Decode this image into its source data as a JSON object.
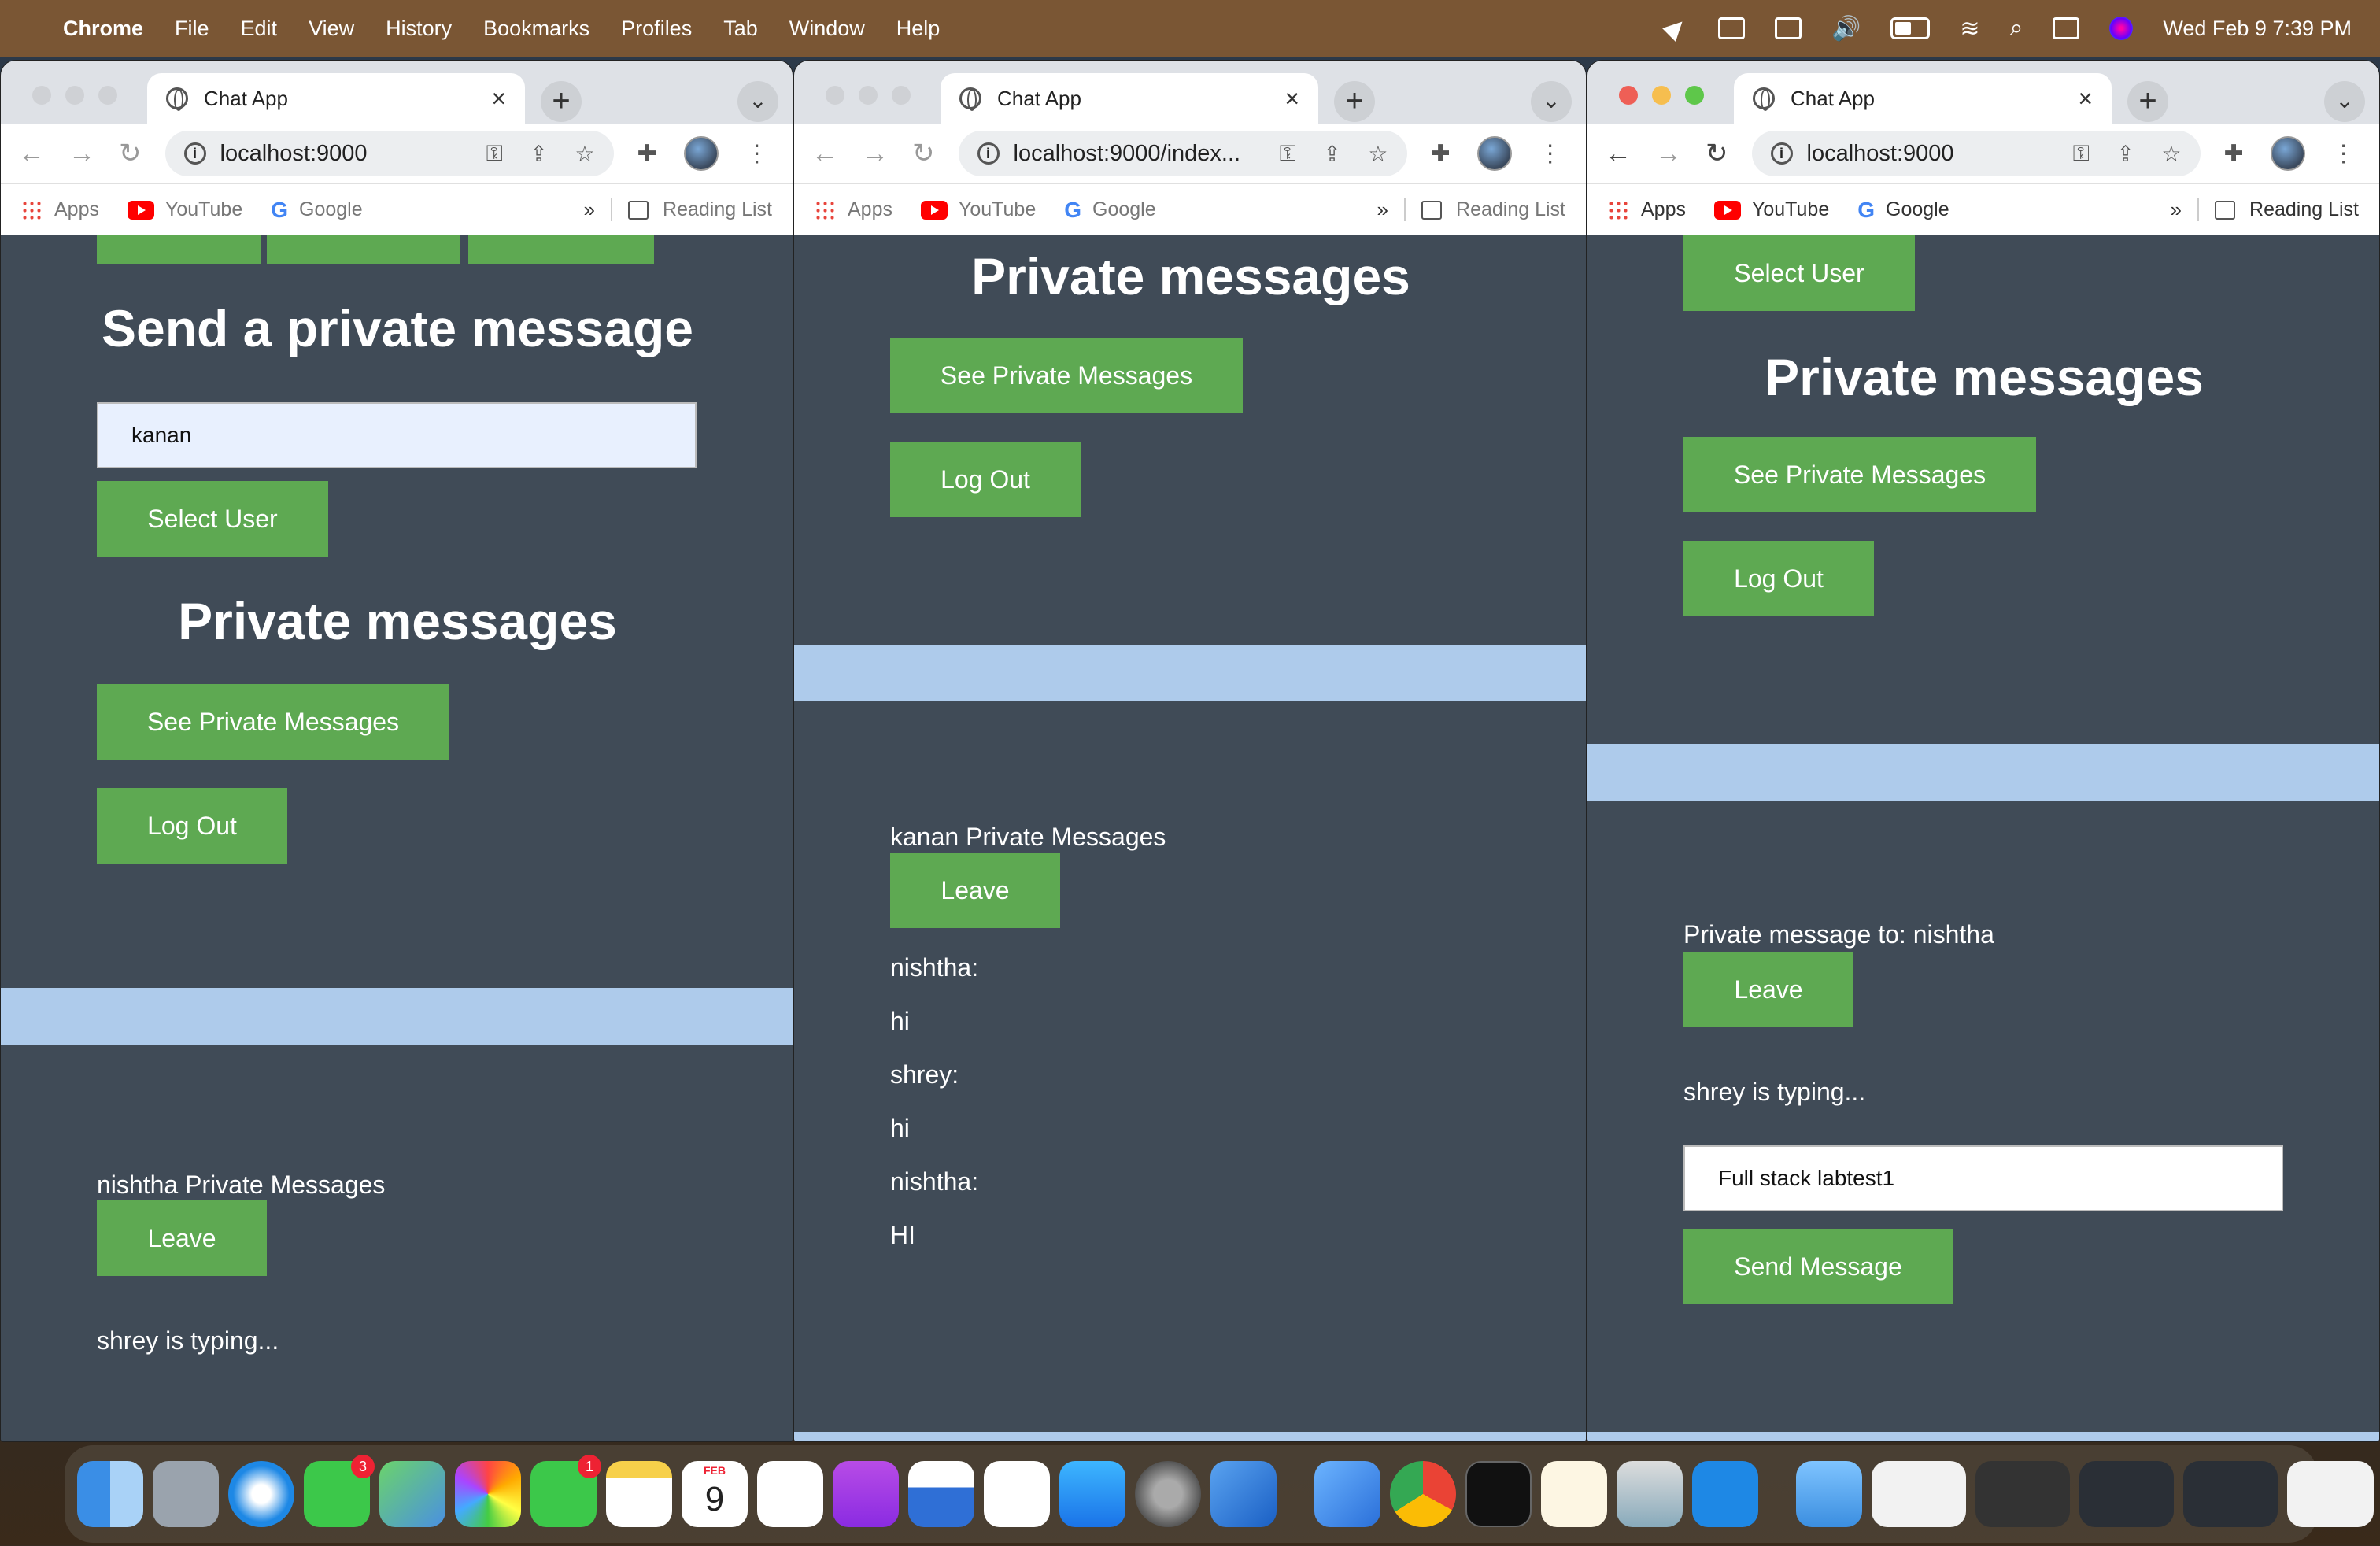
{
  "menubar": {
    "app": "Chrome",
    "items": [
      "File",
      "Edit",
      "View",
      "History",
      "Bookmarks",
      "Profiles",
      "Tab",
      "Window",
      "Help"
    ],
    "datetime": "Wed Feb 9  7:39 PM"
  },
  "browser": {
    "tab_title": "Chat App",
    "bookmarks": {
      "apps": "Apps",
      "youtube": "YouTube",
      "google": "Google",
      "more": "»",
      "reading_list": "Reading List"
    }
  },
  "windows": [
    {
      "url": "localhost:9000",
      "send_heading": "Send a private message",
      "user_input_value": "kanan",
      "select_user": "Select User",
      "private_heading": "Private messages",
      "see_private": "See Private Messages",
      "log_out": "Log Out",
      "chat_label": "nishtha Private Messages",
      "leave": "Leave",
      "typing": "shrey is typing..."
    },
    {
      "url": "localhost:9000/index...",
      "private_heading": "Private messages",
      "see_private": "See Private Messages",
      "log_out": "Log Out",
      "chat_label": "kanan Private Messages",
      "leave": "Leave",
      "messages": [
        "nishtha:",
        "hi",
        "shrey:",
        "hi",
        "nishtha:",
        "HI"
      ]
    },
    {
      "url": "localhost:9000",
      "select_user": "Select User",
      "private_heading": "Private messages",
      "see_private": "See Private Messages",
      "log_out": "Log Out",
      "chat_label": "Private message to: nishtha",
      "leave": "Leave",
      "typing": "shrey is typing...",
      "message_input_value": "Full stack labtest1",
      "send": "Send Message"
    }
  ],
  "dock": {
    "messages_badge": "3",
    "facetime_badge": "1",
    "calendar_month": "FEB",
    "calendar_day": "9"
  },
  "colors": {
    "page_bg": "#404b57",
    "button": "#5ea952",
    "band": "#aecbeb",
    "menubar": "#7a5634"
  }
}
